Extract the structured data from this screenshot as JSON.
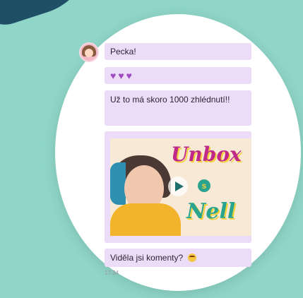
{
  "messages": [
    {
      "text": "Pecka!"
    },
    {
      "hearts": "♥♥♥"
    },
    {
      "text": "Už to má skoro 1000 zhlédnutí!!"
    },
    {
      "video": {
        "title_line1": "Unbox",
        "title_mid": "s",
        "title_line2": "Nell"
      }
    },
    {
      "text": "Viděla jsi komenty?"
    }
  ],
  "timestamp": "17:34"
}
